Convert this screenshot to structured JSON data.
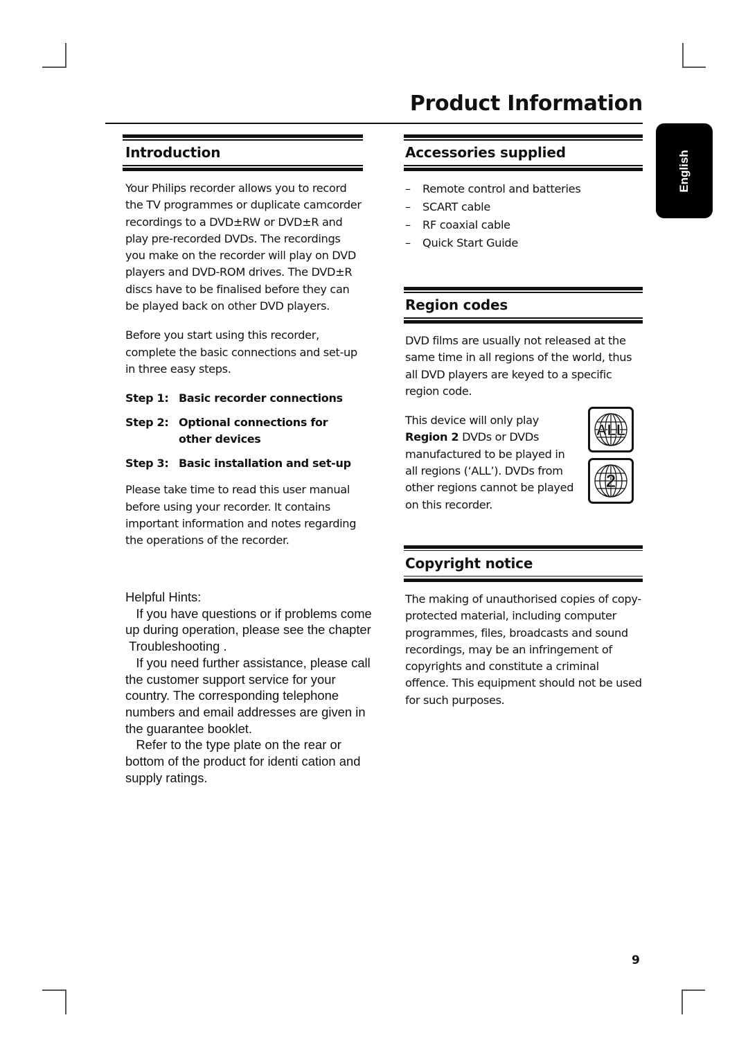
{
  "page": {
    "title": "Product Information",
    "language_tab": "English",
    "page_number": "9"
  },
  "introduction": {
    "heading": "Introduction",
    "paragraph1": "Your Philips recorder allows you to record the TV programmes or duplicate camcorder recordings to a DVD±RW or DVD±R and play pre-recorded DVDs. The recordings you make on the recorder will play on DVD players and DVD-ROM drives. The DVD±R discs have to be finalised before they can be played back on other DVD players.",
    "paragraph2": "Before you start using this recorder, complete the basic connections and set-up in three easy steps.",
    "steps": [
      {
        "label": "Step 1:",
        "text": "Basic recorder connections"
      },
      {
        "label": "Step 2:",
        "text": "Optional connections for other devices"
      },
      {
        "label": "Step 3:",
        "text": "Basic installation and set-up"
      }
    ],
    "paragraph3": "Please take time to read this user manual before using your recorder. It contains important information and notes regarding the operations of the recorder."
  },
  "helpful_hints": {
    "heading": "Helpful Hints:",
    "lines": [
      "   If you have questions or if problems come",
      "up during operation, please see the chapter",
      " Troubleshooting .",
      "   If you need further assistance, please call",
      "the customer support service for your",
      "country. The corresponding telephone",
      "numbers and email addresses are given in",
      "the guarantee booklet.",
      "   Refer to the type plate on the rear or",
      "bottom of the product for identi cation and",
      "supply ratings."
    ]
  },
  "accessories": {
    "heading": "Accessories supplied",
    "dash": "–",
    "items": [
      "Remote control and batteries",
      "SCART cable",
      "RF coaxial cable",
      "Quick Start Guide"
    ]
  },
  "region_codes": {
    "heading": "Region codes",
    "paragraph1": "DVD films are usually not released at the same time in all regions of the world, thus all DVD players are keyed to a specific region code.",
    "paragraph2_pre": "This device will only play ",
    "paragraph2_bold": "Region 2",
    "paragraph2_post": " DVDs or DVDs manufactured to be played in all regions (‘ALL’). DVDs from other regions cannot be played on this recorder.",
    "icons": [
      {
        "icon": "region-all-globe-icon",
        "label": "ALL"
      },
      {
        "icon": "region-2-globe-icon",
        "label": "2"
      }
    ]
  },
  "copyright": {
    "heading": "Copyright notice",
    "paragraph": "The making of unauthorised copies of copy-protected material, including computer programmes, files, broadcasts and sound recordings, may be an infringement of copyrights and constitute a criminal offence. This equipment should not be used for such purposes."
  }
}
